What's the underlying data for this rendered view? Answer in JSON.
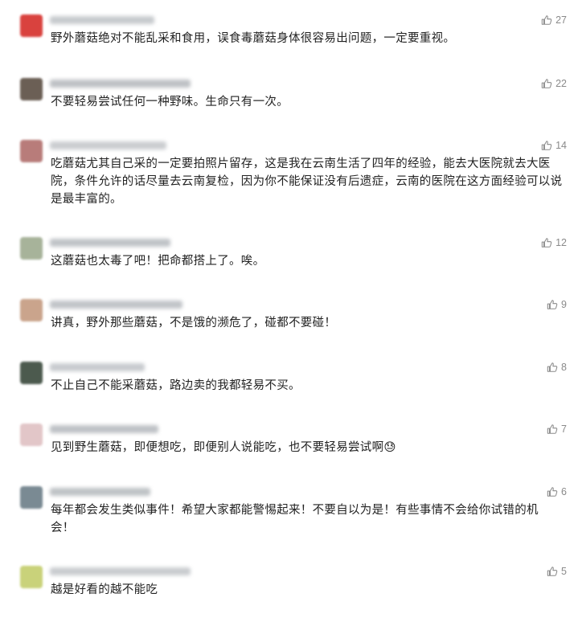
{
  "comments": [
    {
      "text": "野外蘑菇绝对不能乱采和食用，误食毒蘑菇身体很容易出问题，一定要重视。",
      "likes": "27",
      "avatar_color": "#d9423e",
      "name_color": "#9aa0a6"
    },
    {
      "text": "不要轻易尝试任何一种野味。生命只有一次。",
      "likes": "22",
      "avatar_color": "#6b5f55",
      "name_color": "#8a8f96"
    },
    {
      "text": "吃蘑菇尤其自己采的一定要拍照片留存，这是我在云南生活了四年的经验，能去大医院就去大医院，条件允许的话尽量去云南复检，因为你不能保证没有后遗症，云南的医院在这方面经验可以说是最丰富的。",
      "likes": "14",
      "avatar_color": "#b87c7a",
      "name_color": "#a0a4aa"
    },
    {
      "text": "这蘑菇也太毒了吧！把命都搭上了。唉。",
      "likes": "12",
      "avatar_color": "#a7b39a",
      "name_color": "#8d939a"
    },
    {
      "text": "讲真，野外那些蘑菇，不是饿的濒危了，碰都不要碰！",
      "likes": "9",
      "avatar_color": "#caa48c",
      "name_color": "#8f959c"
    },
    {
      "text": "不止自己不能采蘑菇，路边卖的我都轻易不买。",
      "likes": "8",
      "avatar_color": "#4c5a4e",
      "name_color": "#9ba1a8"
    },
    {
      "text": "见到野生蘑菇，即便想吃，即便别人说能吃，也不要轻易尝试啊😓",
      "likes": "7",
      "avatar_color": "#e2c6c8",
      "name_color": "#8a9097"
    },
    {
      "text": "每年都会发生类似事件！希望大家都能警惕起来！不要自以为是！有些事情不会给你试错的机会！",
      "likes": "6",
      "avatar_color": "#7a8a93",
      "name_color": "#8c9298"
    },
    {
      "text": "越是好看的越不能吃",
      "likes": "5",
      "avatar_color": "#c9d27a",
      "name_color": "#9ea3a9"
    }
  ]
}
